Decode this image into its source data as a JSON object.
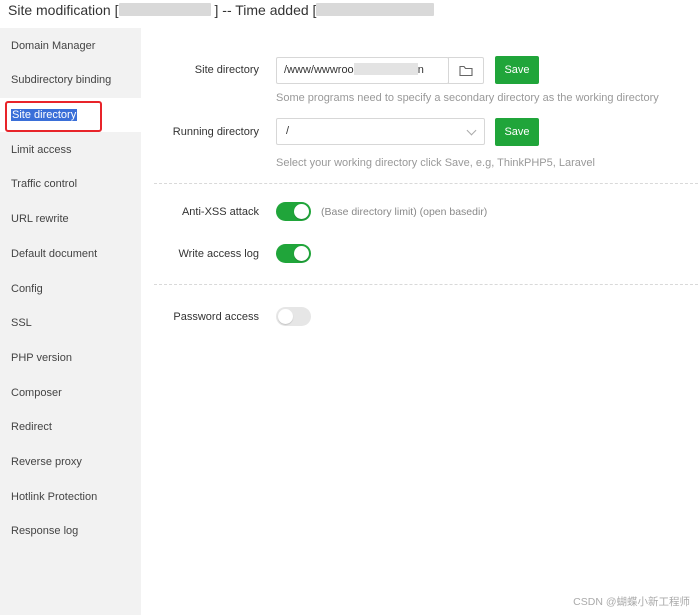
{
  "window": {
    "title_prefix": "Site modification [",
    "title_middle": "] -- Time added ["
  },
  "sidebar": {
    "items": [
      {
        "label": "Domain Manager"
      },
      {
        "label": "Subdirectory binding"
      },
      {
        "label": "Site directory",
        "active": true
      },
      {
        "label": "Limit access"
      },
      {
        "label": "Traffic control"
      },
      {
        "label": "URL rewrite"
      },
      {
        "label": "Default document"
      },
      {
        "label": "Config"
      },
      {
        "label": "SSL"
      },
      {
        "label": "PHP version"
      },
      {
        "label": "Composer"
      },
      {
        "label": "Redirect"
      },
      {
        "label": "Reverse proxy"
      },
      {
        "label": "Hotlink Protection"
      },
      {
        "label": "Response log"
      }
    ]
  },
  "site_directory": {
    "label": "Site directory",
    "value_start": "/www/wwwroo",
    "value_end": "n",
    "save_label": "Save",
    "hint": "Some programs need to specify a secondary directory as the working directory"
  },
  "running_directory": {
    "label": "Running directory",
    "value": "/",
    "save_label": "Save",
    "hint": "Select your working directory click Save, e.g, ThinkPHP5, Laravel"
  },
  "anti_xss": {
    "label": "Anti-XSS attack",
    "enabled": true,
    "description": "(Base directory limit) (open basedir)"
  },
  "access_log": {
    "label": "Write access log",
    "enabled": true
  },
  "password_access": {
    "label": "Password access",
    "enabled": false
  },
  "watermark": "CSDN @蝴蝶小新工程师",
  "colors": {
    "accent": "#20a53a",
    "sidebar_bg": "#f2f2f2",
    "highlight": "#3a6fd8",
    "annotation": "#e8242a"
  }
}
